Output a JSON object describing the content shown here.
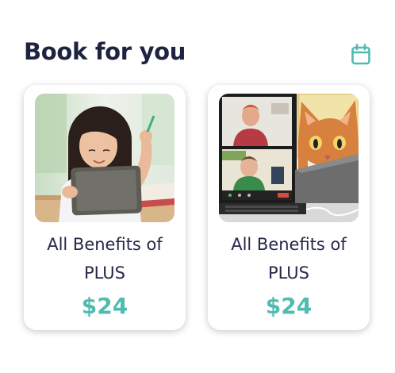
{
  "section": {
    "title": "Book for you",
    "icon": "calendar-icon",
    "accent_color": "#4fbcb0"
  },
  "cards": [
    {
      "image": "girl-with-tablet-photo",
      "title_line1": "All Benefits of",
      "title_line2": "PLUS",
      "price": "$24"
    },
    {
      "image": "video-call-laptop-cat-illustration",
      "title_line1": "All Benefits of",
      "title_line2": "PLUS",
      "price": "$24"
    }
  ]
}
